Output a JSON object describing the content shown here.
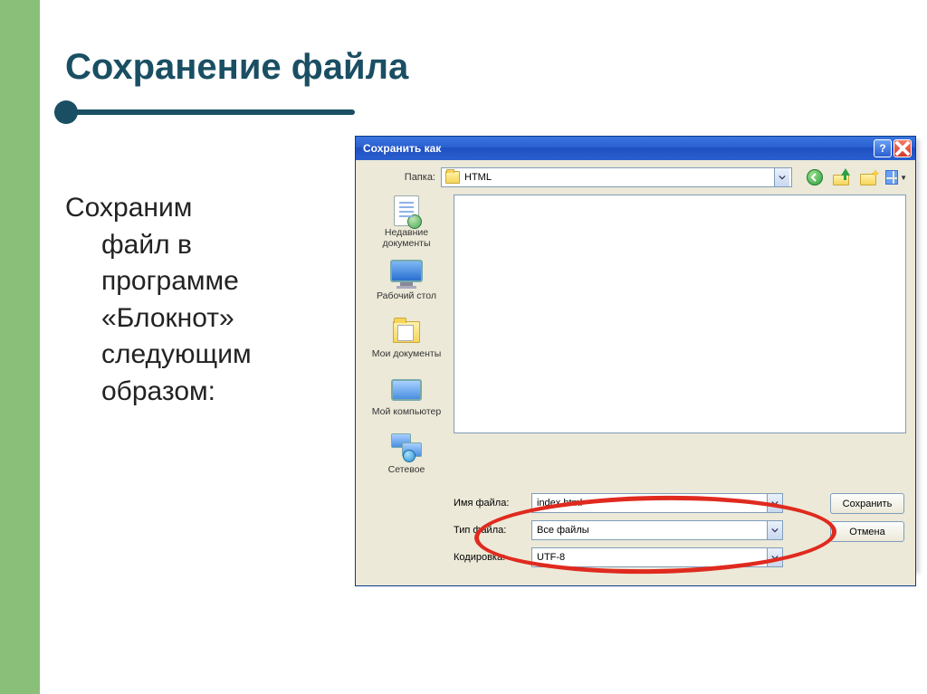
{
  "slide": {
    "title": "Сохранение файла",
    "body_line1": "Сохраним",
    "body_rest": "файл в программе «Блокнот» следующим образом:"
  },
  "dialog": {
    "title": "Сохранить как",
    "folder_label": "Папка:",
    "current_folder": "HTML",
    "places": {
      "recent": "Недавние документы",
      "desktop": "Рабочий стол",
      "mydocs": "Мои документы",
      "mycomputer": "Мой компьютер",
      "network": "Сетевое"
    },
    "filename_label": "Имя файла:",
    "filename_value": "index.html",
    "filetype_label": "Тип файла:",
    "filetype_value": "Все файлы",
    "encoding_label": "Кодировка:",
    "encoding_value": "UTF-8",
    "save_btn": "Сохранить",
    "cancel_btn": "Отмена"
  },
  "colors": {
    "accent_band": "#8abf7a",
    "title": "#1a4f63",
    "highlight": "#e02a1f",
    "xp_blue": "#2a5fd0"
  }
}
